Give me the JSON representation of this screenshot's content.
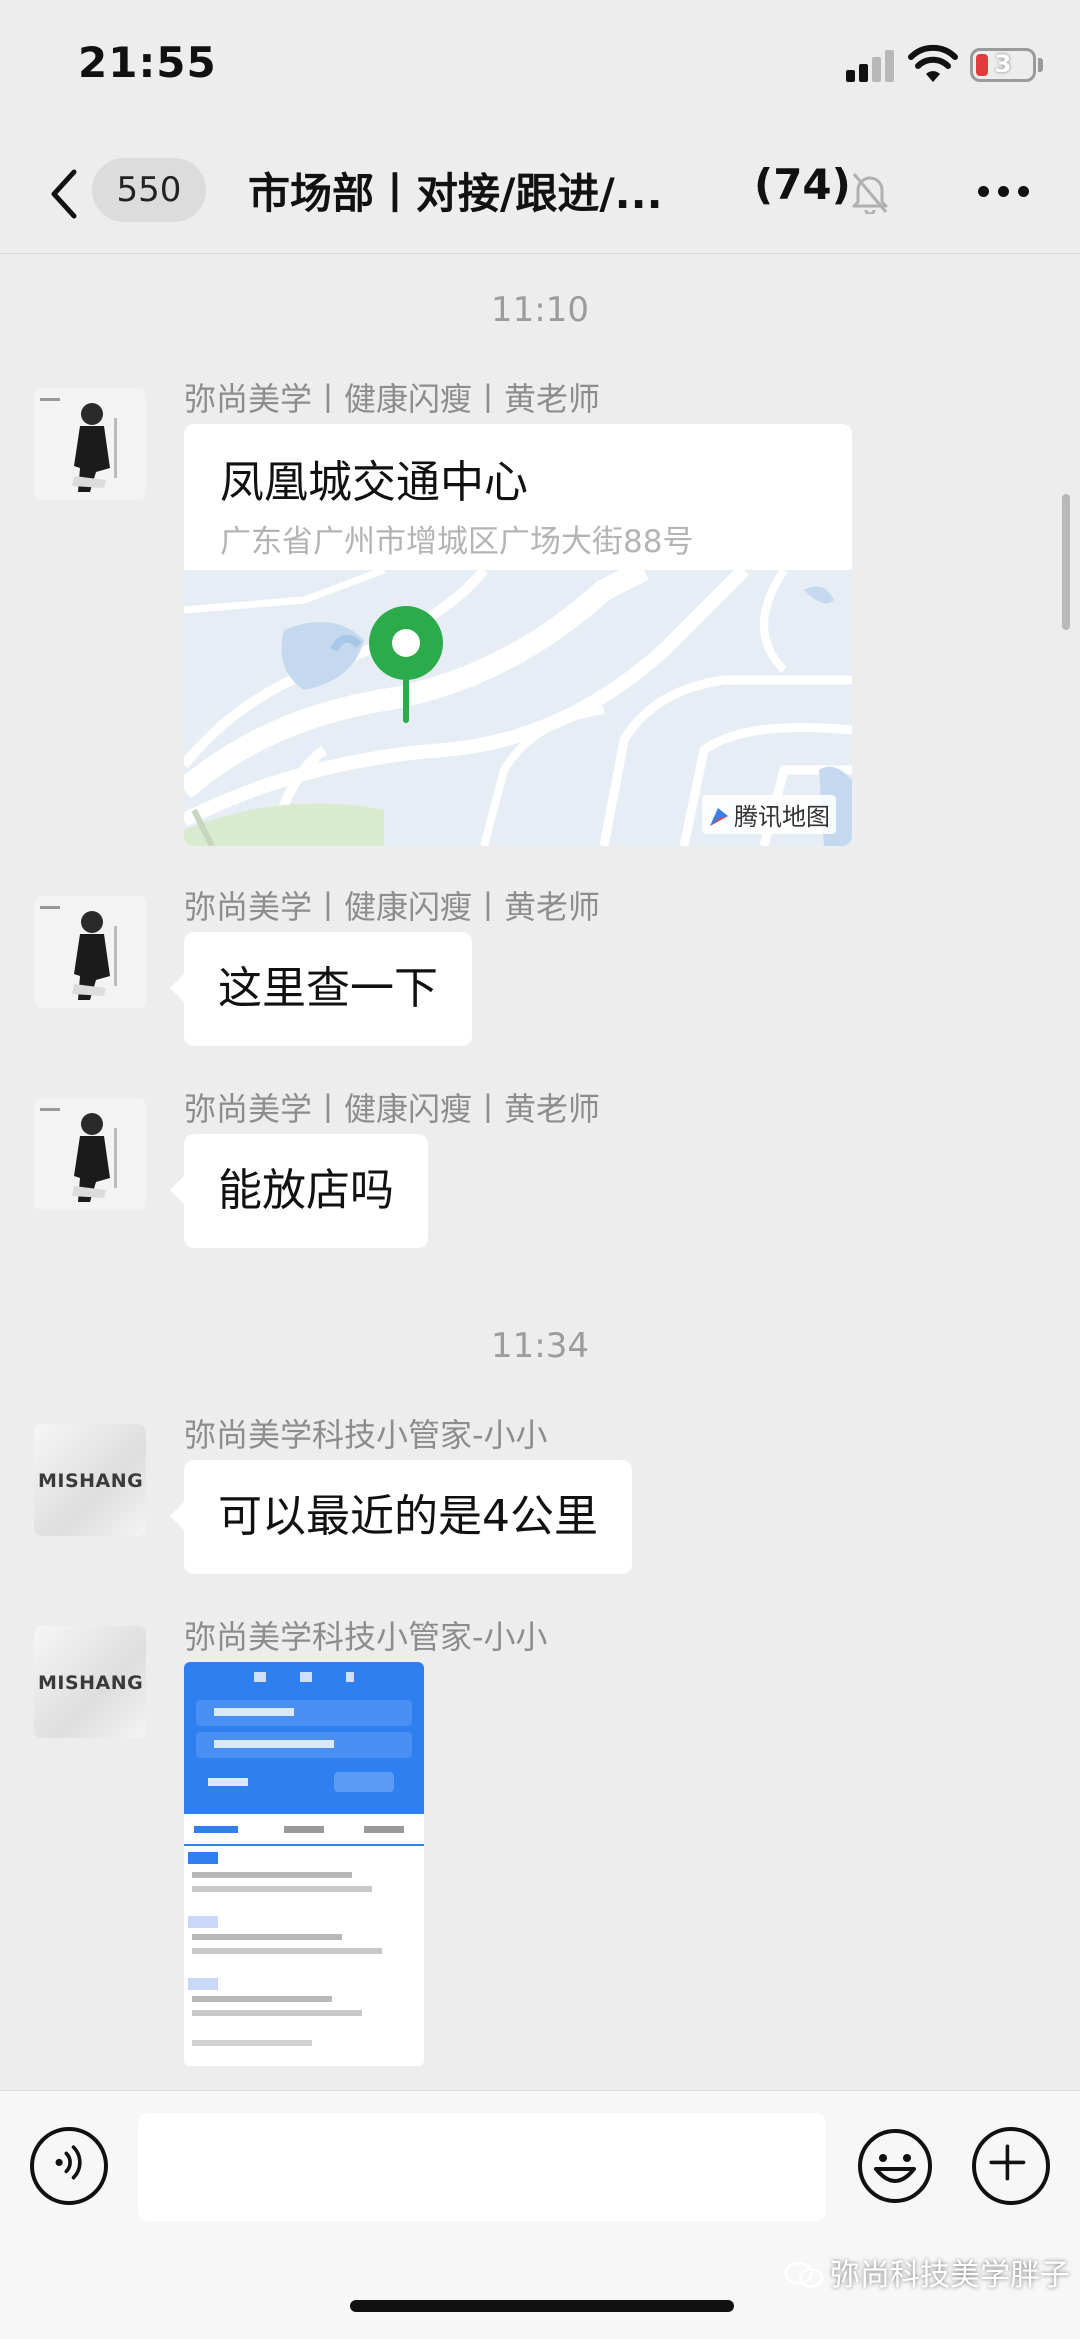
{
  "status_bar": {
    "time": "21:55",
    "battery_level": "3"
  },
  "nav": {
    "unread_count": "550",
    "title": "市场部丨对接/跟进/...",
    "member_count": "(74)"
  },
  "messages": {
    "timestamp_1": "11:10",
    "timestamp_2": "11:34",
    "m1": {
      "sender": "弥尚美学丨健康闪瘦丨黄老师",
      "location_name": "凤凰城交通中心",
      "location_address": "广东省广州市增城区广场大街88号",
      "map_provider": "腾讯地图"
    },
    "m2": {
      "sender": "弥尚美学丨健康闪瘦丨黄老师",
      "text": "这里查一下"
    },
    "m3": {
      "sender": "弥尚美学丨健康闪瘦丨黄老师",
      "text": "能放店吗"
    },
    "m4": {
      "sender": "弥尚美学科技小管家-小小",
      "text": "可以最近的是4公里",
      "avatar_brand": "MISHANG"
    },
    "m5": {
      "sender": "弥尚美学科技小管家-小小",
      "avatar_brand": "MISHANG"
    }
  },
  "watermark": "弥尚科技美学胖子",
  "icons": {
    "back": "chevron-left-icon",
    "mute": "bell-muted-icon",
    "more": "more-dots-icon",
    "voice": "voice-icon",
    "emoji": "emoji-icon",
    "plus": "plus-icon"
  },
  "colors": {
    "background": "#ededed",
    "bubble": "#ffffff",
    "map_pin": "#2bab4a",
    "sender_text": "#8d8d8d"
  }
}
